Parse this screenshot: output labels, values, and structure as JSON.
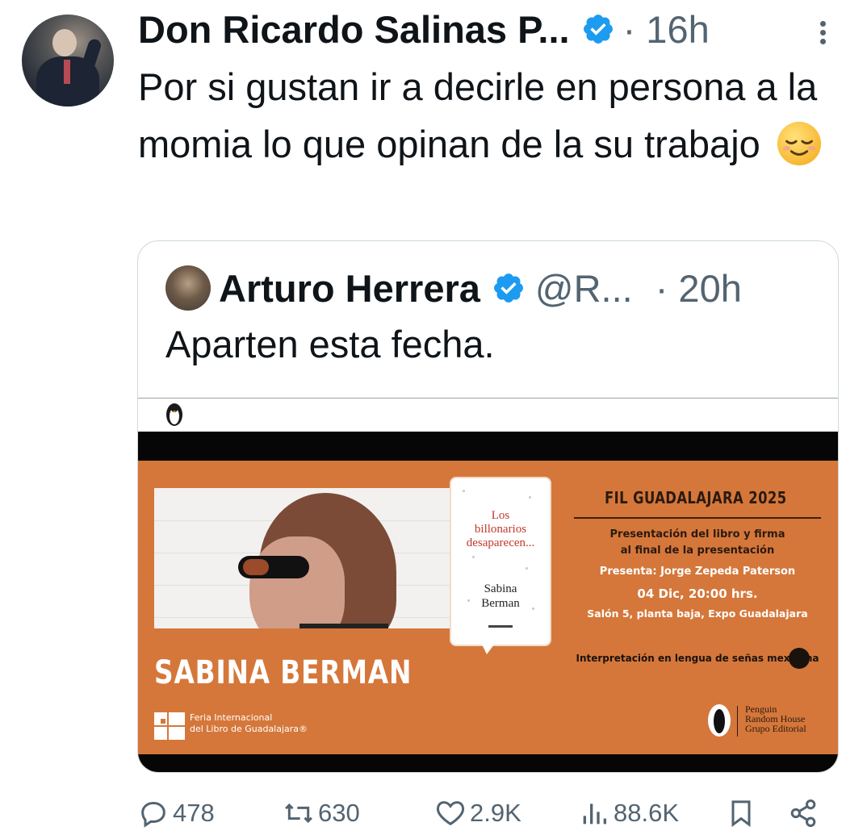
{
  "tweet": {
    "author_name": "Don Ricardo Salinas P...",
    "time": "· 16h",
    "text": "Por si gustan ir a decirle en persona a la momia lo que opinan de la su trabajo",
    "emoji": "relieved-face"
  },
  "quoted": {
    "author_name": "Arturo Herrera",
    "handle": "@R...",
    "time": "· 20h",
    "text": "Aparten esta fecha."
  },
  "poster": {
    "fil_title": "FIL GUADALAJARA 2025",
    "presentation_line1": "Presentación del libro y firma",
    "presentation_line2": "al final de la presentación",
    "presenter": "Presenta: Jorge Zepeda Paterson",
    "date": "04 Dic, 20:00 hrs.",
    "place": "Salón 5, planta baja, Expo Guadalajara",
    "interpretation": "Interpretación en lengua de señas mexicana",
    "author_big": "SABINA BERMAN",
    "book_title_1": "Los",
    "book_title_2": "billonarios",
    "book_title_3": "desaparecen...",
    "book_author_1": "Sabina",
    "book_author_2": "Berman",
    "feria_line1": "Feria Internacional",
    "feria_line2": "del Libro de Guadalajara®",
    "publisher_1": "Penguin",
    "publisher_2": "Random House",
    "publisher_3": "Grupo Editorial",
    "colors": {
      "orange": "#d5773a",
      "black": "#060606"
    }
  },
  "actions": {
    "replies": "478",
    "reposts": "630",
    "likes": "2.9K",
    "views": "88.6K"
  },
  "colors": {
    "verified": "#1d9bf0",
    "secondary_text": "#536471"
  }
}
